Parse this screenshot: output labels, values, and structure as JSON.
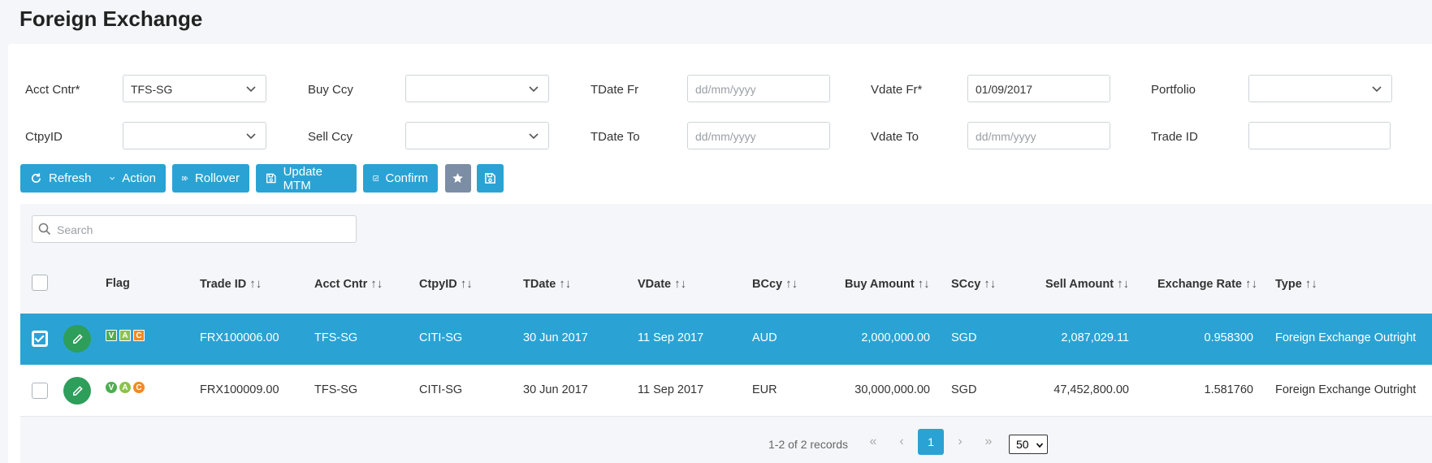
{
  "page": {
    "title": "Foreign Exchange"
  },
  "filters": {
    "acct_cntr_label": "Acct Cntr*",
    "acct_cntr_value": "TFS-SG",
    "buy_ccy_label": "Buy Ccy",
    "buy_ccy_value": "",
    "tdate_fr_label": "TDate Fr",
    "tdate_fr_placeholder": "dd/mm/yyyy",
    "vdate_fr_label": "Vdate Fr*",
    "vdate_fr_value": "01/09/2017",
    "portfolio_label": "Portfolio",
    "portfolio_value": "",
    "ctpy_id_label": "CtpyID",
    "ctpy_id_value": "",
    "sell_ccy_label": "Sell Ccy",
    "sell_ccy_value": "",
    "tdate_to_label": "TDate To",
    "tdate_to_placeholder": "dd/mm/yyyy",
    "vdate_to_label": "Vdate To",
    "vdate_to_placeholder": "dd/mm/yyyy",
    "trade_id_label": "Trade ID",
    "trade_id_value": ""
  },
  "toolbar": {
    "refresh": "Refresh",
    "action": "Action",
    "rollover": "Rollover",
    "update_mtm": "Update MTM",
    "confirm": "Confirm",
    "favorite_icon": "star-icon",
    "save_icon": "floppy-disk-icon"
  },
  "search": {
    "placeholder": "Search"
  },
  "table": {
    "columns": [
      "Flag",
      "Trade ID",
      "Acct Cntr",
      "CtpyID",
      "TDate",
      "VDate",
      "BCcy",
      "Buy Amount",
      "SCcy",
      "Sell Amount",
      "Exchange Rate",
      "Type"
    ],
    "sort_glyph": "↑↓",
    "rows": [
      {
        "selected": true,
        "flags": [
          "V",
          "A",
          "C"
        ],
        "trade_id": "FRX100006.00",
        "acct_cntr": "TFS-SG",
        "ctpy_id": "CITI-SG",
        "tdate": "30 Jun 2017",
        "vdate": "11 Sep 2017",
        "bccy": "AUD",
        "buy_amount": "2,000,000.00",
        "sccy": "SGD",
        "sell_amount": "2,087,029.11",
        "exchange_rate": "0.958300",
        "type": "Foreign Exchange Outright"
      },
      {
        "selected": false,
        "flags": [
          "V",
          "A",
          "C"
        ],
        "trade_id": "FRX100009.00",
        "acct_cntr": "TFS-SG",
        "ctpy_id": "CITI-SG",
        "tdate": "30 Jun 2017",
        "vdate": "11 Sep 2017",
        "bccy": "EUR",
        "buy_amount": "30,000,000.00",
        "sccy": "SGD",
        "sell_amount": "47,452,800.00",
        "exchange_rate": "1.581760",
        "type": "Foreign Exchange Outright"
      }
    ]
  },
  "pagination": {
    "summary": "1-2 of 2 records",
    "first": "«",
    "prev": "‹",
    "current": "1",
    "next": "›",
    "last": "»",
    "page_size": "50"
  },
  "colors": {
    "accent": "#2aa3d4",
    "edit": "#2e9e5b",
    "flag_v": "#4caf50",
    "flag_a": "#8bc34a",
    "flag_c": "#f5891f"
  }
}
